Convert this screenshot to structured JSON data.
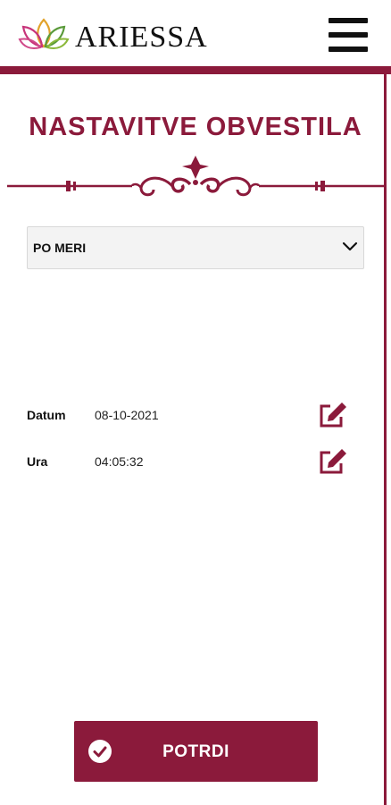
{
  "header": {
    "brand": "ARIESSA",
    "logo_icon": "lotus-logo-icon",
    "menu_icon": "hamburger-menu-icon"
  },
  "page": {
    "title": "NASTAVITVE OBVESTILA",
    "ornament_icon": "decorative-divider-icon"
  },
  "frequency": {
    "selected": "PO MERI",
    "icon": "chevron-down-icon"
  },
  "schedule": {
    "date_label": "Datum",
    "date_value": "08-10-2021",
    "time_label": "Ura",
    "time_value": "04:05:32",
    "edit_icon": "edit-icon"
  },
  "actions": {
    "confirm_label": "POTRDI",
    "confirm_icon": "check-circle-icon"
  },
  "colors": {
    "accent": "#8b1a3b",
    "background": "#ffffff"
  }
}
